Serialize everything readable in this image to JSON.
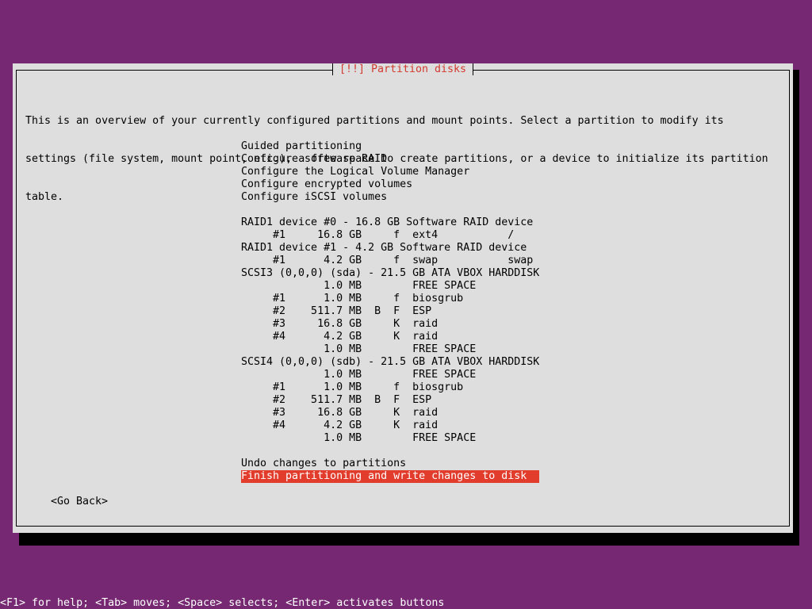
{
  "colors": {
    "background": "#762873",
    "dialog": "#dedede",
    "title": "#d23a2e",
    "highlight": "#e23c2c"
  },
  "dialog": {
    "title": "[!!] Partition disks",
    "intro": [
      "This is an overview of your currently configured partitions and mount points. Select a partition to modify its",
      "settings (file system, mount point, etc.), a free space to create partitions, or a device to initialize its partition",
      "table."
    ],
    "menu": [
      "Guided partitioning",
      "Configure software RAID",
      "Configure the Logical Volume Manager",
      "Configure encrypted volumes",
      "Configure iSCSI volumes",
      "",
      "RAID1 device #0 - 16.8 GB Software RAID device",
      "     #1     16.8 GB     f  ext4           /",
      "RAID1 device #1 - 4.2 GB Software RAID device",
      "     #1      4.2 GB     f  swap           swap",
      "SCSI3 (0,0,0) (sda) - 21.5 GB ATA VBOX HARDDISK",
      "             1.0 MB        FREE SPACE",
      "     #1      1.0 MB     f  biosgrub",
      "     #2    511.7 MB  B  F  ESP",
      "     #3     16.8 GB     K  raid",
      "     #4      4.2 GB     K  raid",
      "             1.0 MB        FREE SPACE",
      "SCSI4 (0,0,0) (sdb) - 21.5 GB ATA VBOX HARDDISK",
      "             1.0 MB        FREE SPACE",
      "     #1      1.0 MB     f  biosgrub",
      "     #2    511.7 MB  B  F  ESP",
      "     #3     16.8 GB     K  raid",
      "     #4      4.2 GB     K  raid",
      "             1.0 MB        FREE SPACE",
      "",
      "Undo changes to partitions",
      "Finish partitioning and write changes to disk"
    ],
    "go_back": "<Go Back>"
  },
  "help_text": "<F1> for help; <Tab> moves; <Space> selects; <Enter> activates buttons"
}
